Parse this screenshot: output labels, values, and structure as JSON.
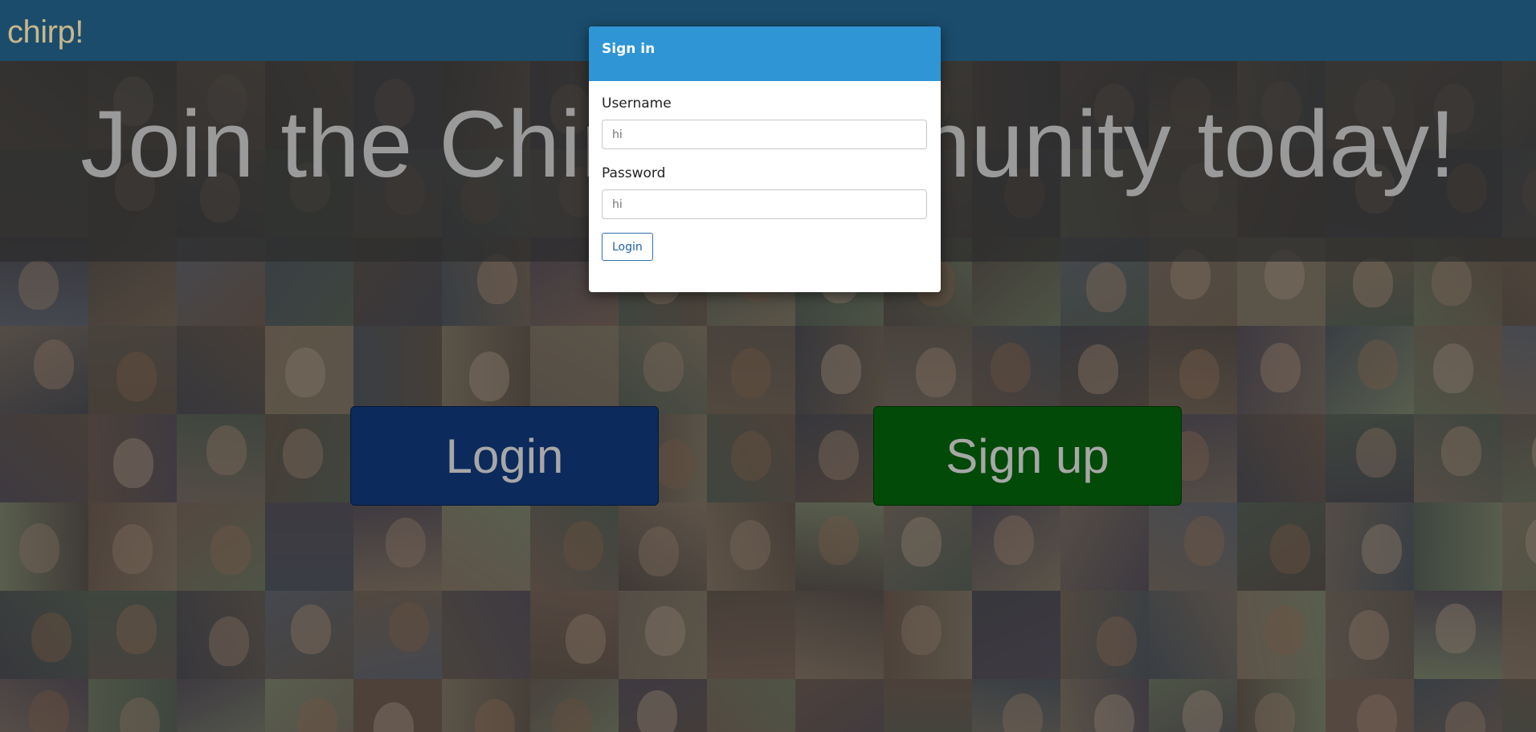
{
  "navbar": {
    "brand": "chirp!"
  },
  "hero": {
    "title": "Join the Chirp Community today!"
  },
  "buttons": {
    "login": "Login",
    "signup": "Sign up"
  },
  "modal": {
    "title": "Sign in",
    "username_label": "Username",
    "username_placeholder": "hi",
    "password_label": "Password",
    "password_placeholder": "hi",
    "submit": "Login"
  },
  "colors": {
    "navbar": "#1b4c6c",
    "brand": "#c9b68a",
    "modal_header": "#2f95d5",
    "login_button": "#0c2a5c",
    "signup_button": "#024a08"
  }
}
